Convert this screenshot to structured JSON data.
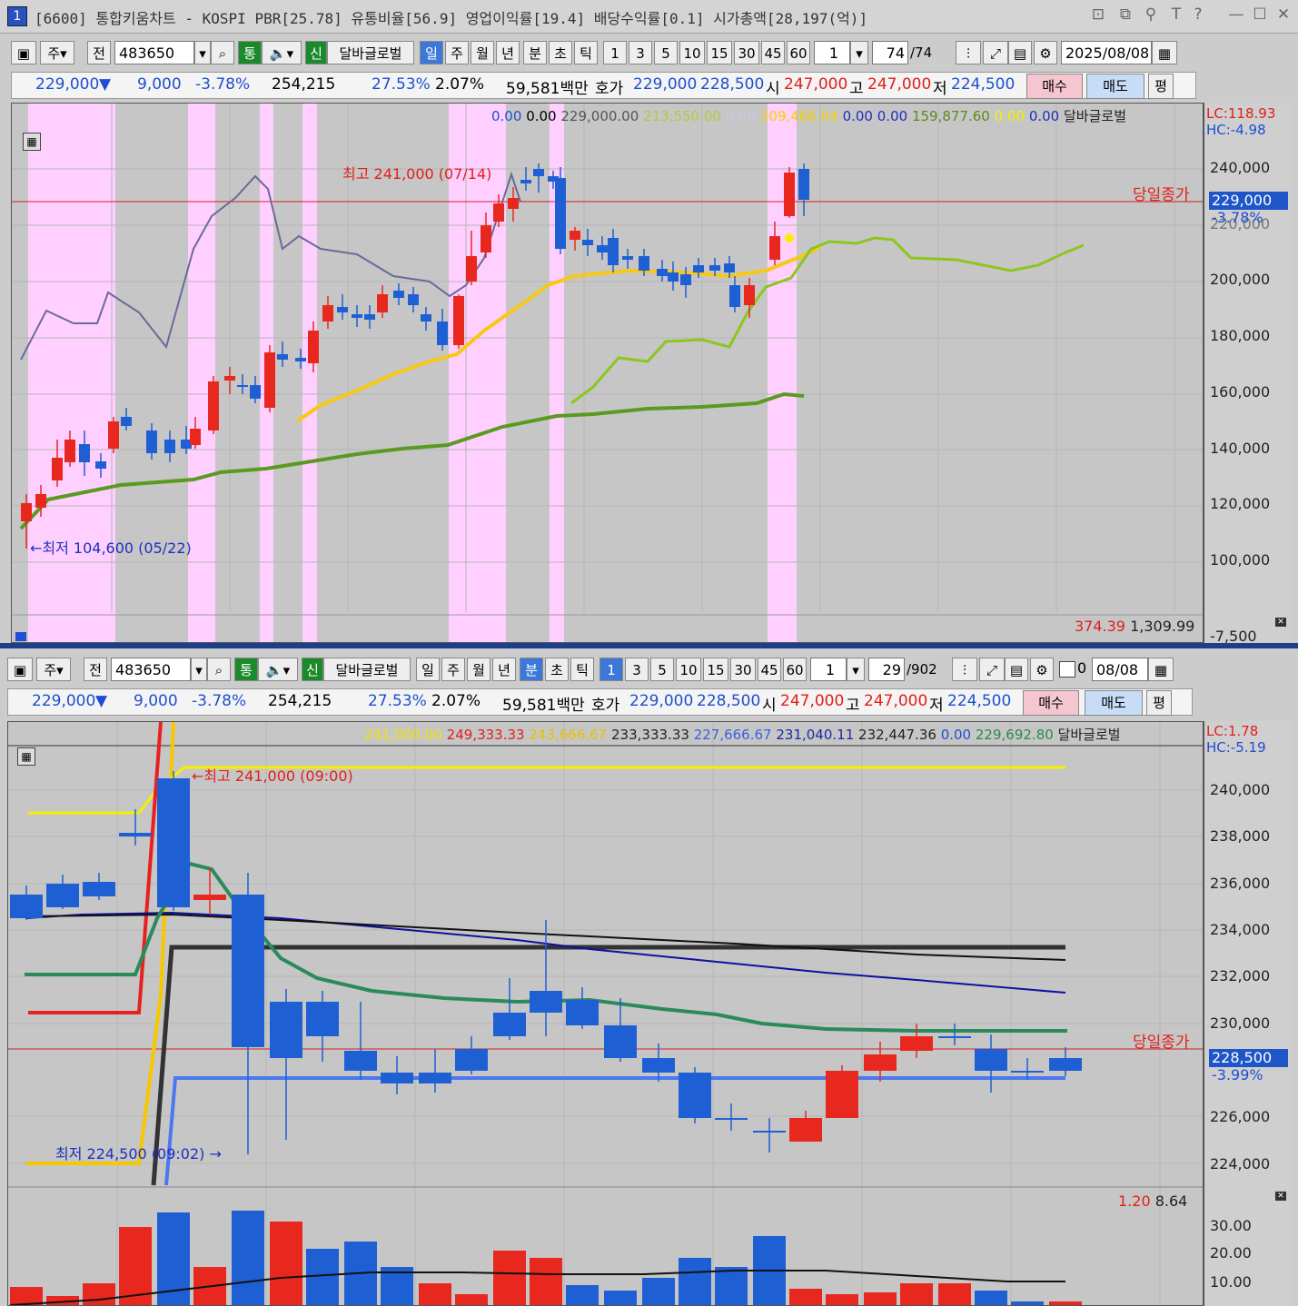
{
  "titlebar": {
    "badge": "1",
    "text": "[6600] 통합키움차트 - KOSPI PBR[25.78] 유통비율[56.9] 영업이익률[19.4] 배당수익률[0.1] 시가총액[28,197(억)]",
    "controls": [
      "⊡",
      "⧉",
      "⚲",
      "T",
      "?",
      "—",
      "☐",
      "✕"
    ]
  },
  "top": {
    "toolbar": {
      "ju": "주",
      "jeon": "전",
      "code": "483650",
      "tong": "통",
      "sin": "신",
      "name": "달바글로벌",
      "periods": [
        "일",
        "주",
        "월",
        "년",
        "분",
        "초",
        "틱"
      ],
      "active_period": "일",
      "nums": [
        "1",
        "3",
        "5",
        "10",
        "15",
        "30",
        "45",
        "60"
      ],
      "mult": "1",
      "count": "74",
      "total": "/74",
      "date": "2025/08/08"
    },
    "quote": {
      "price": "229,000",
      "arrow": "▼",
      "change": "9,000",
      "pct": "-3.78%",
      "volume": "254,215",
      "vol_ratio": "27.53%",
      "turnover": "2.07%",
      "amount": "59,581백만",
      "hoga_label": "호가",
      "ask": "229,000",
      "bid": "228,500",
      "open_label": "시",
      "open": "247,000",
      "high_label": "고",
      "high": "247,000",
      "low_label": "저",
      "low": "224,500",
      "buy": "매수",
      "sell": "매도",
      "avg": "평"
    },
    "legend": [
      "0.00",
      "0.00",
      "229,000.00",
      "213,550.00",
      "0.00",
      "209,466.04",
      "0.00",
      "0.00",
      "159,877.60",
      "0.00",
      "0.00",
      "달바글로벌"
    ],
    "lc": "LC:118.93",
    "hc": "HC:-4.98",
    "closing_label": "당일종가",
    "price_box": "229,000",
    "price_pct": "-3.78%",
    "high_annot": "최고 241,000 (07/14)",
    "low_annot": "←최저 104,600 (05/22)",
    "bottom_values": [
      "374.39",
      "1,309.99"
    ],
    "yaxis": [
      "240,000",
      "220,000",
      "200,000",
      "180,000",
      "160,000",
      "140,000",
      "120,000",
      "100,000",
      "-7,500"
    ]
  },
  "bottom": {
    "toolbar": {
      "ju": "주",
      "jeon": "전",
      "code": "483650",
      "tong": "통",
      "sin": "신",
      "name": "달바글로벌",
      "periods": [
        "일",
        "주",
        "월",
        "년",
        "분",
        "초",
        "틱"
      ],
      "active_period": "분",
      "nums": [
        "1",
        "3",
        "5",
        "10",
        "15",
        "30",
        "45",
        "60"
      ],
      "active_num": "1",
      "mult": "1",
      "count": "29",
      "total": "/902",
      "chk": "0",
      "date": "08/08"
    },
    "quote": {
      "price": "229,000",
      "arrow": "▼",
      "change": "9,000",
      "pct": "-3.78%",
      "volume": "254,215",
      "vol_ratio": "27.53%",
      "turnover": "2.07%",
      "amount": "59,581백만",
      "hoga_label": "호가",
      "ask": "229,000",
      "bid": "228,500",
      "open_label": "시",
      "open": "247,000",
      "high_label": "고",
      "high": "247,000",
      "low_label": "저",
      "low": "224,500",
      "buy": "매수",
      "sell": "매도",
      "avg": "평"
    },
    "legend": [
      "241,000.00",
      "249,333.33",
      "243,666.67",
      "233,333.33",
      "227,666.67",
      "231,040.11",
      "232,447.36",
      "0.00",
      "229,692.80",
      "달바글로벌"
    ],
    "lc": "LC:1.78",
    "hc": "HC:-5.19",
    "closing_label": "당일종가",
    "price_box": "228,500",
    "price_pct": "-3.99%",
    "high_annot": "←최고 241,000 (09:00)",
    "low_annot": "최저 224,500 (09:02) →",
    "vol_values": [
      "1.20",
      "8.64"
    ],
    "yaxis": [
      "240,000",
      "238,000",
      "236,000",
      "234,000",
      "232,000",
      "230,000",
      "226,000",
      "224,000"
    ],
    "vol_axis": [
      "30.00",
      "20.00",
      "10.00"
    ]
  },
  "colors": {
    "up": "#e8281e",
    "down": "#1f5fd4",
    "pink": "#ffd0ff",
    "ma_yellow": "#f7c815",
    "ma_green": "#5a9a1e",
    "ma_lime": "#8cc61e",
    "line_purple": "#6a6a9a"
  }
}
